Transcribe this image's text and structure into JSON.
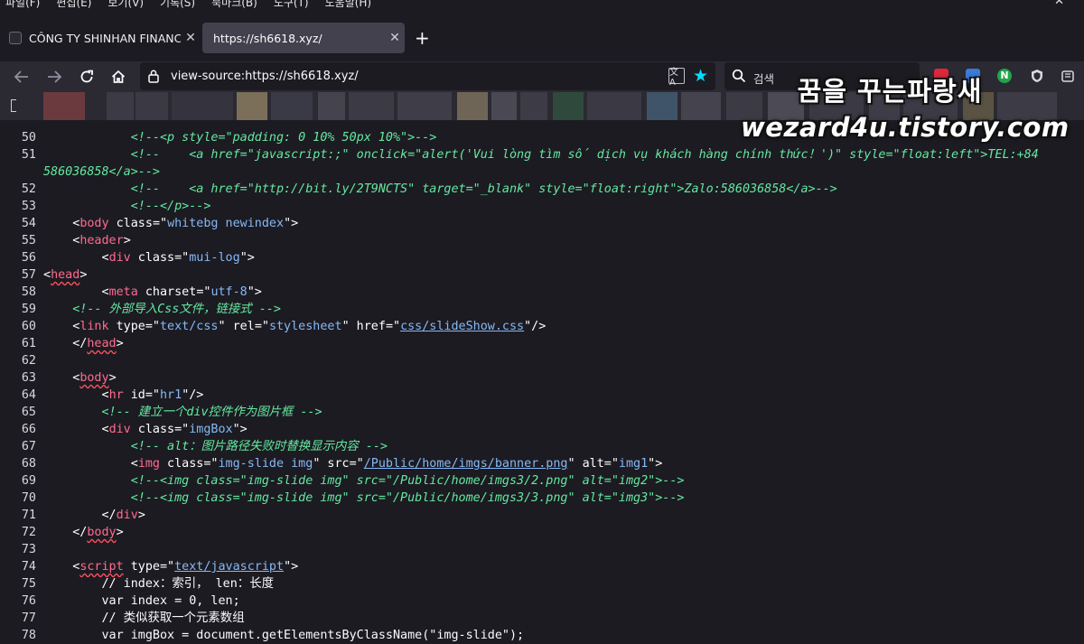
{
  "menu": {
    "items": [
      "파일(F)",
      "편집(E)",
      "보기(V)",
      "기록(S)",
      "북마크(B)",
      "도구(T)",
      "도움말(H)"
    ],
    "close_glyph": "✕"
  },
  "tabs": [
    {
      "title": "CÔNG TY SHINHAN FINANCE",
      "active": false
    },
    {
      "title": "https://sh6618.xyz/",
      "active": true
    }
  ],
  "navbar": {
    "url": "view-source:https://sh6618.xyz/",
    "search_placeholder": "검색"
  },
  "watermark": {
    "line1": "꿈을 꾸는파랑새",
    "line2": "wezard4u.tistory.com"
  },
  "colors": {
    "background": "#1c1b22",
    "toolbar": "#2b2a33",
    "tag_name": "#ff6b8e",
    "attr_value": "#86b8f5",
    "comment": "#64e9a0",
    "star": "#00ddff"
  },
  "source_lines": [
    {
      "n": "50",
      "indent": "            ",
      "segs": [
        {
          "c": "cm",
          "t": "<!--<p style=\"padding: 0 10% 50px 10%\">-->"
        }
      ]
    },
    {
      "n": "51",
      "indent": "            ",
      "segs": [
        {
          "c": "cm",
          "t": "<!--    <a href=\"javascript:;\" onclick=\"alert('Vui lòng tìm số dịch vụ khách hàng chính thức！')\" style=\"float:left\">TEL:+84"
        }
      ]
    },
    {
      "n": "",
      "indent": "",
      "segs": [
        {
          "c": "cm",
          "t": "586036858</a>-->"
        }
      ]
    },
    {
      "n": "52",
      "indent": "            ",
      "segs": [
        {
          "c": "cm",
          "t": "<!--    <a href=\"http://bit.ly/2T9NCTS\" target=\"_blank\" style=\"float:right\">Zalo:586036858</a>-->"
        }
      ]
    },
    {
      "n": "53",
      "indent": "            ",
      "segs": [
        {
          "c": "cm",
          "t": "<!--</p>-->"
        }
      ]
    },
    {
      "n": "54",
      "indent": "    ",
      "segs": [
        {
          "c": "tag",
          "t": "<"
        },
        {
          "c": "tn",
          "t": "body"
        },
        {
          "c": "an",
          "t": " class"
        },
        {
          "c": "tag",
          "t": "=\""
        },
        {
          "c": "av",
          "t": "whitebg newindex"
        },
        {
          "c": "tag",
          "t": "\">"
        }
      ]
    },
    {
      "n": "55",
      "indent": "    ",
      "segs": [
        {
          "c": "tag",
          "t": "<"
        },
        {
          "c": "tn",
          "t": "header"
        },
        {
          "c": "tag",
          "t": ">"
        }
      ]
    },
    {
      "n": "56",
      "indent": "        ",
      "segs": [
        {
          "c": "tag",
          "t": "<"
        },
        {
          "c": "tn",
          "t": "div"
        },
        {
          "c": "an",
          "t": " class"
        },
        {
          "c": "tag",
          "t": "=\""
        },
        {
          "c": "av",
          "t": "mui-log"
        },
        {
          "c": "tag",
          "t": "\">"
        }
      ]
    },
    {
      "n": "57",
      "indent": "",
      "segs": [
        {
          "c": "tag",
          "t": "<"
        },
        {
          "c": "tn err",
          "t": "head"
        },
        {
          "c": "tag",
          "t": ">"
        }
      ]
    },
    {
      "n": "58",
      "indent": "        ",
      "segs": [
        {
          "c": "tag",
          "t": "<"
        },
        {
          "c": "tn",
          "t": "meta"
        },
        {
          "c": "an",
          "t": " charset"
        },
        {
          "c": "tag",
          "t": "=\""
        },
        {
          "c": "av",
          "t": "utf-8"
        },
        {
          "c": "tag",
          "t": "\">"
        }
      ]
    },
    {
      "n": "59",
      "indent": "    ",
      "segs": [
        {
          "c": "cm",
          "t": "<!-- 外部导入Css文件，链接式 -->"
        }
      ]
    },
    {
      "n": "60",
      "indent": "    ",
      "segs": [
        {
          "c": "tag",
          "t": "<"
        },
        {
          "c": "tn",
          "t": "link"
        },
        {
          "c": "an",
          "t": " type"
        },
        {
          "c": "tag",
          "t": "=\""
        },
        {
          "c": "av",
          "t": "text/css"
        },
        {
          "c": "tag",
          "t": "\""
        },
        {
          "c": "an",
          "t": " rel"
        },
        {
          "c": "tag",
          "t": "=\""
        },
        {
          "c": "av",
          "t": "stylesheet"
        },
        {
          "c": "tag",
          "t": "\""
        },
        {
          "c": "an",
          "t": " href"
        },
        {
          "c": "tag",
          "t": "=\""
        },
        {
          "c": "lnk",
          "t": "css/slideShow.css"
        },
        {
          "c": "tag",
          "t": "\"/>"
        }
      ]
    },
    {
      "n": "61",
      "indent": "    ",
      "segs": [
        {
          "c": "tag",
          "t": "</"
        },
        {
          "c": "tn err",
          "t": "head"
        },
        {
          "c": "tag",
          "t": ">"
        }
      ]
    },
    {
      "n": "62",
      "indent": "",
      "segs": []
    },
    {
      "n": "63",
      "indent": "    ",
      "segs": [
        {
          "c": "tag",
          "t": "<"
        },
        {
          "c": "tn err",
          "t": "body"
        },
        {
          "c": "tag",
          "t": ">"
        }
      ]
    },
    {
      "n": "64",
      "indent": "        ",
      "segs": [
        {
          "c": "tag",
          "t": "<"
        },
        {
          "c": "tn",
          "t": "hr"
        },
        {
          "c": "an",
          "t": " id"
        },
        {
          "c": "tag",
          "t": "=\""
        },
        {
          "c": "av",
          "t": "hr1"
        },
        {
          "c": "tag",
          "t": "\"/>"
        }
      ]
    },
    {
      "n": "65",
      "indent": "        ",
      "segs": [
        {
          "c": "cm",
          "t": "<!-- 建立一个div控件作为图片框 -->"
        }
      ]
    },
    {
      "n": "66",
      "indent": "        ",
      "segs": [
        {
          "c": "tag",
          "t": "<"
        },
        {
          "c": "tn",
          "t": "div"
        },
        {
          "c": "an",
          "t": " class"
        },
        {
          "c": "tag",
          "t": "=\""
        },
        {
          "c": "av",
          "t": "imgBox"
        },
        {
          "c": "tag",
          "t": "\">"
        }
      ]
    },
    {
      "n": "67",
      "indent": "            ",
      "segs": [
        {
          "c": "cm",
          "t": "<!-- alt：图片路径失败时替换显示内容 -->"
        }
      ]
    },
    {
      "n": "68",
      "indent": "            ",
      "segs": [
        {
          "c": "tag",
          "t": "<"
        },
        {
          "c": "tn",
          "t": "img"
        },
        {
          "c": "an",
          "t": " class"
        },
        {
          "c": "tag",
          "t": "=\""
        },
        {
          "c": "av",
          "t": "img-slide img"
        },
        {
          "c": "tag",
          "t": "\""
        },
        {
          "c": "an",
          "t": " src"
        },
        {
          "c": "tag",
          "t": "=\""
        },
        {
          "c": "lnk",
          "t": "/Public/home/imgs/banner.png"
        },
        {
          "c": "tag",
          "t": "\""
        },
        {
          "c": "an",
          "t": " alt"
        },
        {
          "c": "tag",
          "t": "=\""
        },
        {
          "c": "av",
          "t": "img1"
        },
        {
          "c": "tag",
          "t": "\">"
        }
      ]
    },
    {
      "n": "69",
      "indent": "            ",
      "segs": [
        {
          "c": "cm",
          "t": "<!--<img class=\"img-slide img\" src=\"/Public/home/imgs3/2.png\" alt=\"img2\">-->"
        }
      ]
    },
    {
      "n": "70",
      "indent": "            ",
      "segs": [
        {
          "c": "cm",
          "t": "<!--<img class=\"img-slide img\" src=\"/Public/home/imgs3/3.png\" alt=\"img3\">-->"
        }
      ]
    },
    {
      "n": "71",
      "indent": "        ",
      "segs": [
        {
          "c": "tag",
          "t": "</"
        },
        {
          "c": "tn",
          "t": "div"
        },
        {
          "c": "tag",
          "t": ">"
        }
      ]
    },
    {
      "n": "72",
      "indent": "    ",
      "segs": [
        {
          "c": "tag",
          "t": "</"
        },
        {
          "c": "tn err",
          "t": "body"
        },
        {
          "c": "tag",
          "t": ">"
        }
      ]
    },
    {
      "n": "73",
      "indent": "",
      "segs": []
    },
    {
      "n": "74",
      "indent": "    ",
      "segs": [
        {
          "c": "tag",
          "t": "<"
        },
        {
          "c": "tn err",
          "t": "script"
        },
        {
          "c": "an",
          "t": " type"
        },
        {
          "c": "tag",
          "t": "=\""
        },
        {
          "c": "lnk",
          "t": "text/javascript"
        },
        {
          "c": "tag",
          "t": "\">"
        }
      ]
    },
    {
      "n": "75",
      "indent": "        ",
      "segs": [
        {
          "c": "tx",
          "t": "// index：索引， len：长度"
        }
      ]
    },
    {
      "n": "76",
      "indent": "        ",
      "segs": [
        {
          "c": "tx",
          "t": "var index = 0, len;"
        }
      ]
    },
    {
      "n": "77",
      "indent": "        ",
      "segs": [
        {
          "c": "tx",
          "t": "// 类似获取一个元素数组"
        }
      ]
    },
    {
      "n": "78",
      "indent": "        ",
      "segs": [
        {
          "c": "tx",
          "t": "var imgBox = document.getElementsByClassName(\"img-slide\");"
        }
      ]
    }
  ]
}
